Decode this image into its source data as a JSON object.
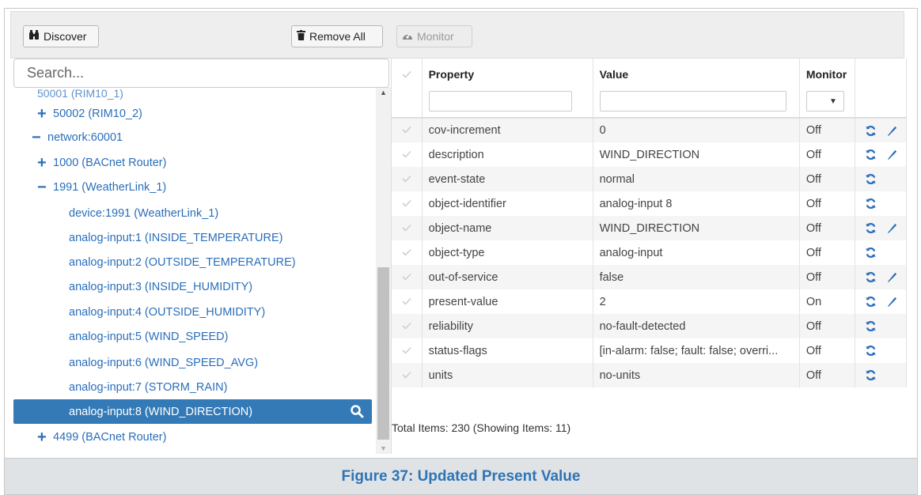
{
  "toolbar": {
    "discover_label": "Discover",
    "remove_all_label": "Remove All",
    "monitor_label": "Monitor"
  },
  "search": {
    "placeholder": "Search..."
  },
  "tree": {
    "partial_label": "50001 (RIM10_1)",
    "items": [
      {
        "label": "50002 (RIM10_2)",
        "toggle": "+"
      },
      {
        "label": "network:60001",
        "toggle": "−"
      },
      {
        "label": "1000 (BACnet Router)",
        "toggle": "+"
      },
      {
        "label": "1991 (WeatherLink_1)",
        "toggle": "−"
      },
      {
        "label": "device:1991 (WeatherLink_1)",
        "toggle": ""
      },
      {
        "label": "analog-input:1 (INSIDE_TEMPERATURE)",
        "toggle": ""
      },
      {
        "label": "analog-input:2 (OUTSIDE_TEMPERATURE)",
        "toggle": ""
      },
      {
        "label": "analog-input:3 (INSIDE_HUMIDITY)",
        "toggle": ""
      },
      {
        "label": "analog-input:4 (OUTSIDE_HUMIDITY)",
        "toggle": ""
      },
      {
        "label": "analog-input:5 (WIND_SPEED)",
        "toggle": ""
      },
      {
        "label": "analog-input:6 (WIND_SPEED_AVG)",
        "toggle": ""
      },
      {
        "label": "analog-input:7 (STORM_RAIN)",
        "toggle": ""
      },
      {
        "label": "analog-input:8 (WIND_DIRECTION)",
        "toggle": ""
      },
      {
        "label": "4499 (BACnet Router)",
        "toggle": "+"
      }
    ]
  },
  "table": {
    "headers": {
      "property": "Property",
      "value": "Value",
      "monitor": "Monitor"
    },
    "rows": [
      {
        "property": "cov-increment",
        "value": "0",
        "monitor": "Off",
        "write": true
      },
      {
        "property": "description",
        "value": "WIND_DIRECTION",
        "monitor": "Off",
        "write": true
      },
      {
        "property": "event-state",
        "value": "normal",
        "monitor": "Off",
        "write": false
      },
      {
        "property": "object-identifier",
        "value": "analog-input 8",
        "monitor": "Off",
        "write": false
      },
      {
        "property": "object-name",
        "value": "WIND_DIRECTION",
        "monitor": "Off",
        "write": true
      },
      {
        "property": "object-type",
        "value": "analog-input",
        "monitor": "Off",
        "write": false
      },
      {
        "property": "out-of-service",
        "value": "false",
        "monitor": "Off",
        "write": true
      },
      {
        "property": "present-value",
        "value": "2",
        "monitor": "On",
        "write": true
      },
      {
        "property": "reliability",
        "value": "no-fault-detected",
        "monitor": "Off",
        "write": false
      },
      {
        "property": "status-flags",
        "value": "[in-alarm: false; fault: false; overri...",
        "monitor": "Off",
        "write": false
      },
      {
        "property": "units",
        "value": "no-units",
        "monitor": "Off",
        "write": false
      }
    ],
    "footer": "Total Items: 230 (Showing Items: 11)"
  },
  "caption": "Figure 37: Updated Present Value",
  "colors": {
    "accent": "#337ab7",
    "link": "#2a6ebb",
    "caption": "#2e74b5"
  }
}
